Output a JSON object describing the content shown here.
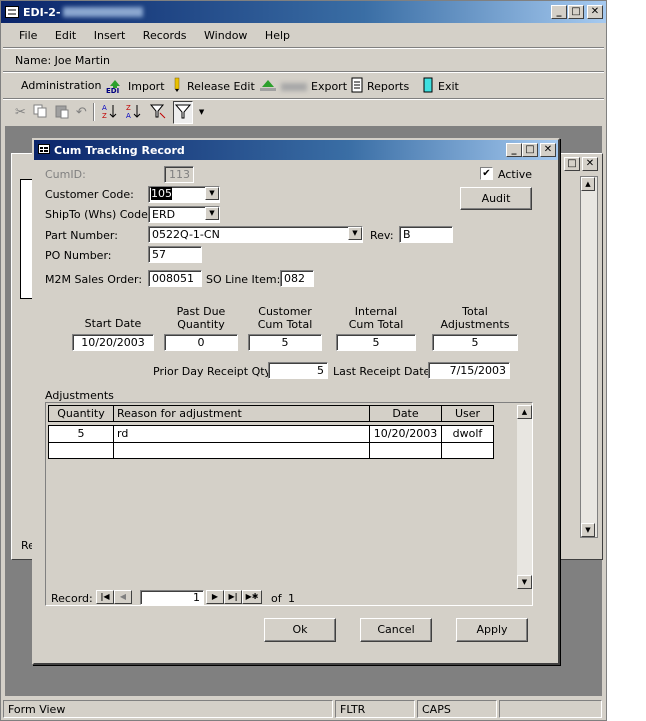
{
  "app": {
    "title": "EDI-2-"
  },
  "menu": [
    "File",
    "Edit",
    "Insert",
    "Records",
    "Window",
    "Help"
  ],
  "user_name": "Name: Joe Martin",
  "toolbar": {
    "administration": "Administration",
    "import": "Import",
    "edi": "EDI",
    "release_edit": "Release Edit",
    "export": "Export",
    "reports": "Reports",
    "exit": "Exit"
  },
  "dialog": {
    "title": "Cum Tracking Record",
    "cumid_label": "CumID:",
    "cumid_value": "113",
    "active_label": "Active",
    "active_checked": true,
    "audit_button": "Audit",
    "customer_code_label": "Customer Code:",
    "customer_code_value": "105",
    "shipto_label": "ShipTo (Whs) Code:",
    "shipto_value": "ERD",
    "part_number_label": "Part Number:",
    "part_number_value": "0522Q-1-CN",
    "rev_label": "Rev:",
    "rev_value": "B",
    "po_label": "PO Number:",
    "po_value": "57",
    "m2m_label": "M2M Sales Order:",
    "m2m_value": "008051",
    "so_line_label": "SO Line Item:",
    "so_line_value": "082",
    "totals": {
      "start_date_label": "Start Date",
      "start_date_value": "10/20/2003",
      "past_due_label_1": "Past Due",
      "past_due_label_2": "Quantity",
      "past_due_value": "0",
      "customer_cum_label_1": "Customer",
      "customer_cum_label_2": "Cum Total",
      "customer_cum_value": "5",
      "internal_cum_label_1": "Internal",
      "internal_cum_label_2": "Cum Total",
      "internal_cum_value": "5",
      "total_adj_label_1": "Total",
      "total_adj_label_2": "Adjustments",
      "total_adj_value": "5"
    },
    "prior_day_label": "Prior Day Receipt Qty",
    "prior_day_value": "5",
    "last_receipt_label": "Last Receipt Date",
    "last_receipt_value": "7/15/2003",
    "adjustments_label": "Adjustments",
    "grid": {
      "columns": [
        "Quantity",
        "Reason for adjustment",
        "Date",
        "User"
      ],
      "rows": [
        [
          "5",
          "rd",
          "10/20/2003",
          "dwolf"
        ]
      ]
    },
    "record_label": "Record:",
    "record_current": "1",
    "record_of": "of",
    "record_total": "1",
    "ok_button": "Ok",
    "cancel_button": "Cancel",
    "apply_button": "Apply"
  },
  "background_form": {
    "fragment_label": "Re"
  },
  "status": {
    "left": "Form View",
    "fltr": "FLTR",
    "caps": "CAPS"
  },
  "colors": {
    "titlebar_start": "#0a246a",
    "titlebar_end": "#a6caf0",
    "face": "#d4d0c8"
  }
}
